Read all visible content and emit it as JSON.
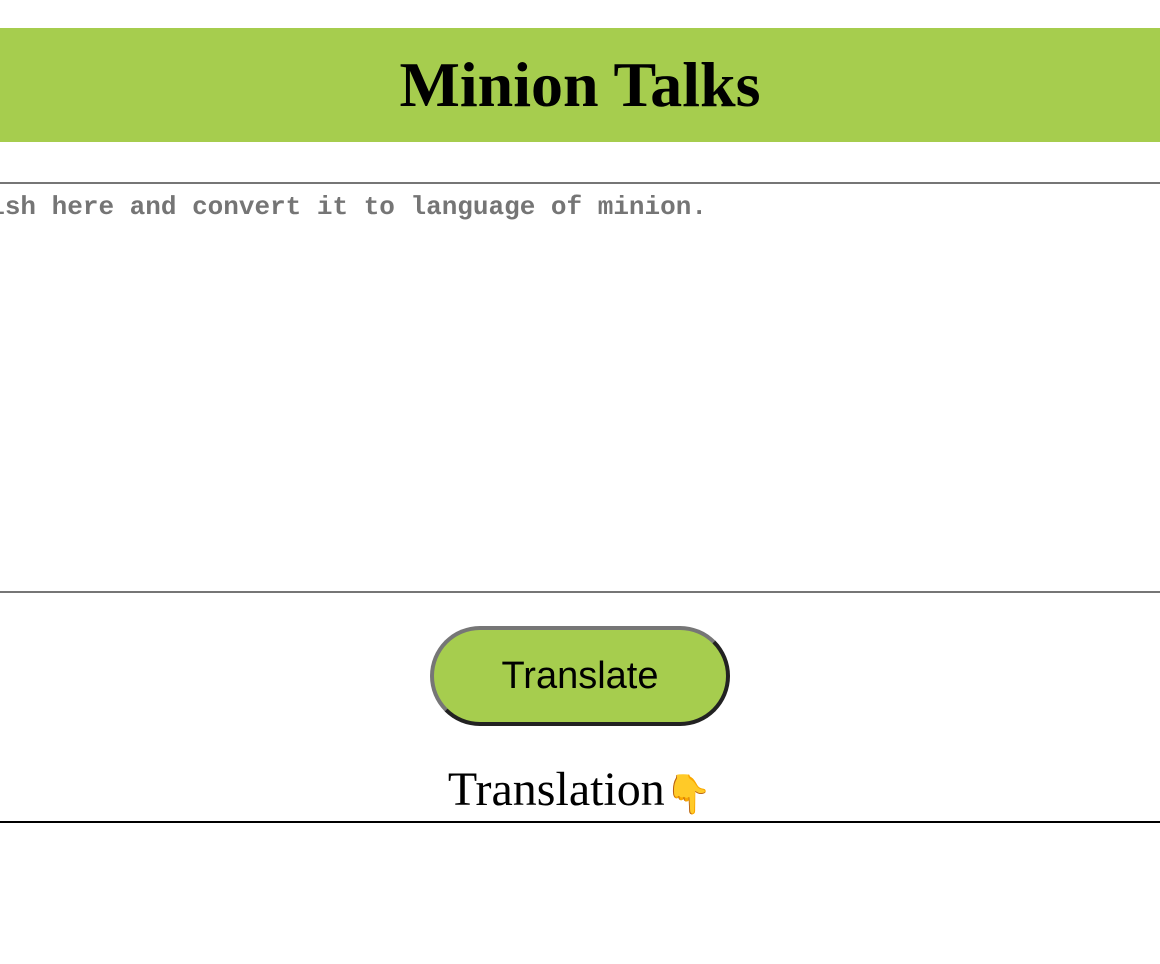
{
  "header": {
    "title": "Minion Talks",
    "background_color": "#a6cd4e"
  },
  "input": {
    "placeholder": "Type in English here and convert it to language of minion.",
    "value": ""
  },
  "translate_button": {
    "label": "Translate",
    "background_color": "#a6cd4e"
  },
  "output": {
    "heading": "Translation",
    "heading_icon": "pointing-down-icon",
    "heading_icon_glyph": "👇",
    "text": ""
  }
}
